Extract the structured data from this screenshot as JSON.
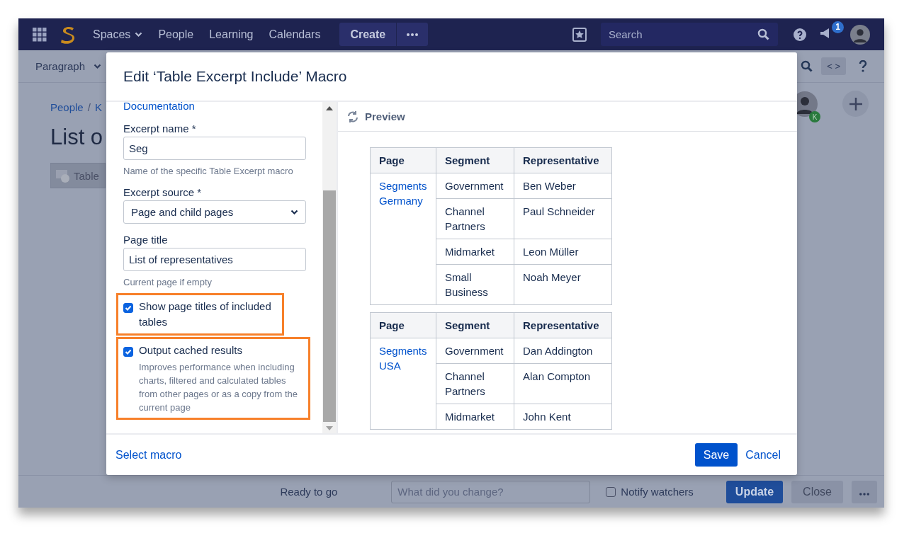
{
  "nav": {
    "items": [
      {
        "label": "Spaces",
        "dropdown": true
      },
      {
        "label": "People",
        "dropdown": false
      },
      {
        "label": "Learning",
        "dropdown": false
      },
      {
        "label": "Calendars",
        "dropdown": false
      }
    ],
    "create": "Create",
    "search": {
      "placeholder": "Search"
    },
    "notifications": "1"
  },
  "toolbar": {
    "style": "Paragraph",
    "source": "< >"
  },
  "page": {
    "breadcrumb": [
      {
        "kind": "link",
        "text": "People"
      },
      {
        "kind": "separator",
        "text": "/"
      },
      {
        "kind": "link",
        "text": "K"
      }
    ],
    "title": "List o",
    "macro": "Table",
    "avatar_badge": "K"
  },
  "dialog": {
    "title": "Edit ‘Table Excerpt Include’ Macro",
    "doc_link": "Documentation",
    "fields": [
      {
        "kind": "text",
        "label": "Excerpt name *",
        "value": "Seg",
        "hint": "Name of the specific Table Excerpt macro"
      },
      {
        "kind": "select",
        "label": "Excerpt source *",
        "value": "Page and child pages"
      },
      {
        "kind": "text",
        "label": "Page title",
        "value": "List of representatives",
        "hint": "Current page if empty"
      }
    ],
    "options": [
      {
        "label": "Show page titles of included tables",
        "checked": true,
        "highlighted": true
      },
      {
        "label": "Output cached results",
        "checked": true,
        "highlighted": true,
        "description": "Improves performance when including charts, filtered and calculated tables from other pages or as a copy from the current page"
      }
    ],
    "preview": {
      "title": "Preview",
      "tables": [
        {
          "columns": [
            "Page",
            "Segment",
            "Representative"
          ],
          "rows": [
            [
              {
                "text": "Segments Germany",
                "rowspan": 4
              },
              "Government",
              "Ben Weber"
            ],
            [
              "Channel Partners",
              "Paul Schneider"
            ],
            [
              "Midmarket",
              "Leon Müller"
            ],
            [
              "Small Business",
              "Noah Meyer"
            ]
          ]
        },
        {
          "columns": [
            "Page",
            "Segment",
            "Representative"
          ],
          "rows": [
            [
              {
                "text": "Segments USA",
                "rowspan": 3
              },
              "Government",
              "Dan Addington"
            ],
            [
              "Channel Partners",
              "Alan Compton"
            ],
            [
              "Midmarket",
              "John Kent"
            ]
          ]
        }
      ]
    },
    "select_macro": "Select macro",
    "save": "Save",
    "cancel": "Cancel"
  },
  "bottom_bar": {
    "status": "Ready to go",
    "comment": {
      "placeholder": "What did you change?"
    },
    "notify": {
      "label": "Notify watchers",
      "checked": false
    },
    "update": "Update",
    "close": "Close"
  }
}
